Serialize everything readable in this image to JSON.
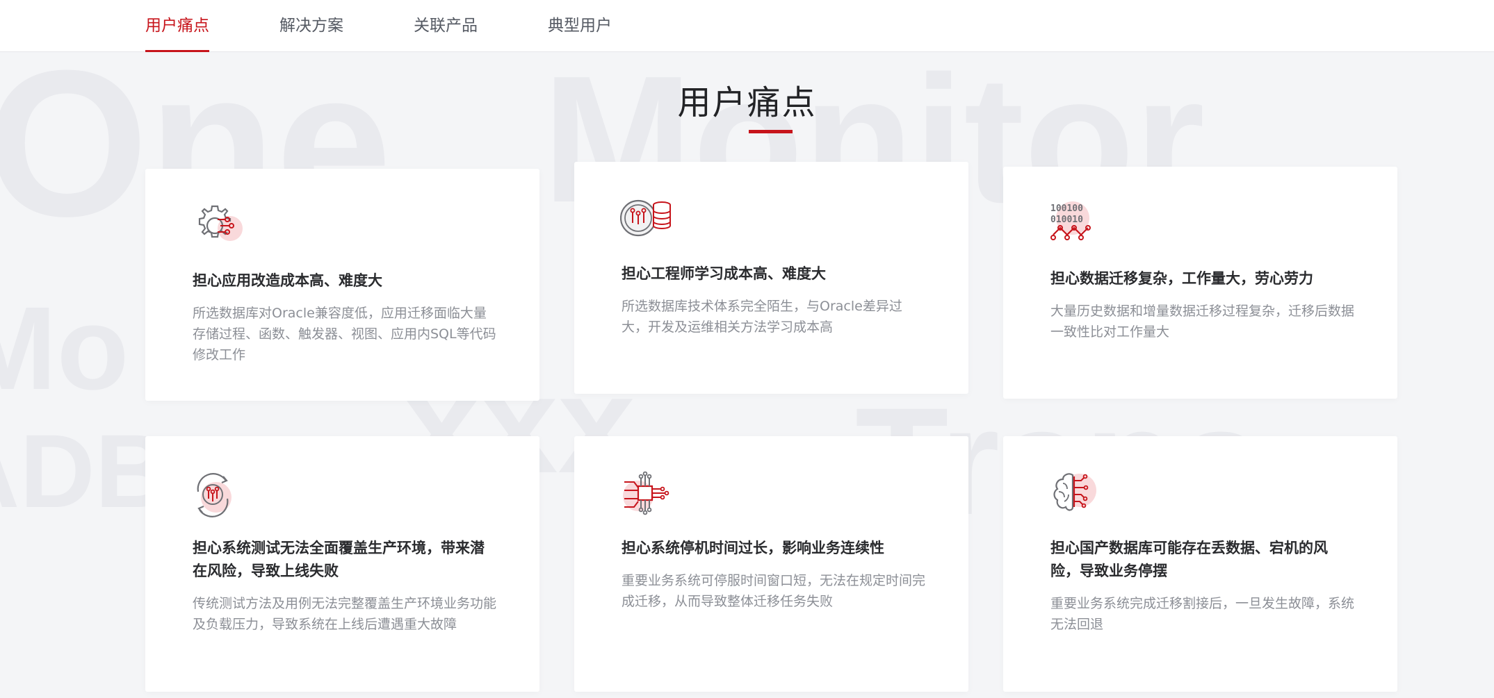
{
  "nav": {
    "tabs": [
      {
        "label": "用户痛点",
        "active": true
      },
      {
        "label": "解决方案",
        "active": false
      },
      {
        "label": "关联产品",
        "active": false
      },
      {
        "label": "典型用户",
        "active": false
      }
    ]
  },
  "section": {
    "title": "用户痛点"
  },
  "colors": {
    "accent": "#c7141b",
    "accent_soft": "#f9d9db",
    "icon_gray": "#6f7075",
    "text_dark": "#2a2b2e",
    "text_muted": "#8c8f96"
  },
  "cards": [
    {
      "icon": "gear-circuit-icon",
      "title": "担心应用改造成本高、难度大",
      "desc": "所选数据库对Oracle兼容度低，应用迁移面临大量存储过程、函数、触发器、视图、应用内SQL等代码修改工作"
    },
    {
      "icon": "database-learning-icon",
      "title": "担心工程师学习成本高、难度大",
      "desc": "所选数据库技术体系完全陌生，与Oracle差异过大，开发及运维相关方法学习成本高"
    },
    {
      "icon": "binary-data-icon",
      "title": "担心数据迁移复杂，工作量大，劳心劳力",
      "desc": "大量历史数据和增量数据迁移过程复杂，迁移后数据一致性比对工作量大"
    },
    {
      "icon": "cycle-test-icon",
      "title": "担心系统测试无法全面覆盖生产环境，带来潜在风险，导致上线失败",
      "desc": "传统测试方法及用例无法完整覆盖生产环境业务功能及负载压力，导致系统在上线后遭遇重大故障"
    },
    {
      "icon": "chip-downtime-icon",
      "title": "担心系统停机时间过长，影响业务连续性",
      "desc": "重要业务系统可停服时间窗口短，无法在规定时间完成迁移，从而导致整体迁移任务失败"
    },
    {
      "icon": "brain-risk-icon",
      "title": "担心国产数据库可能存在丢数据、宕机的风险，导致业务停摆",
      "desc": "重要业务系统完成迁移割接后，一旦发生故障，系统无法回退"
    }
  ]
}
